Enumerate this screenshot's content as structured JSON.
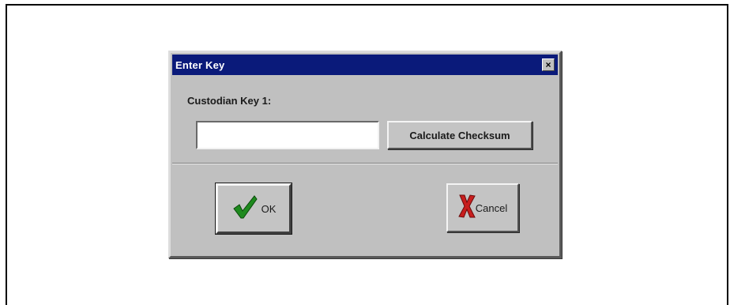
{
  "dialog": {
    "title": "Enter Key",
    "close_glyph": "×",
    "field_label": "Custodian Key 1:",
    "key_input": {
      "value": "",
      "placeholder": ""
    },
    "calculate_label": "Calculate Checksum",
    "ok_label": "OK",
    "cancel_label": "Cancel"
  },
  "icons": {
    "ok": "check-icon",
    "cancel": "x-icon",
    "close": "close-icon"
  },
  "colors": {
    "titlebar": "#0a1a7a",
    "dialog_face": "#c0c0c0",
    "check_green": "#1e8a1e",
    "cancel_red": "#c81e1e"
  }
}
